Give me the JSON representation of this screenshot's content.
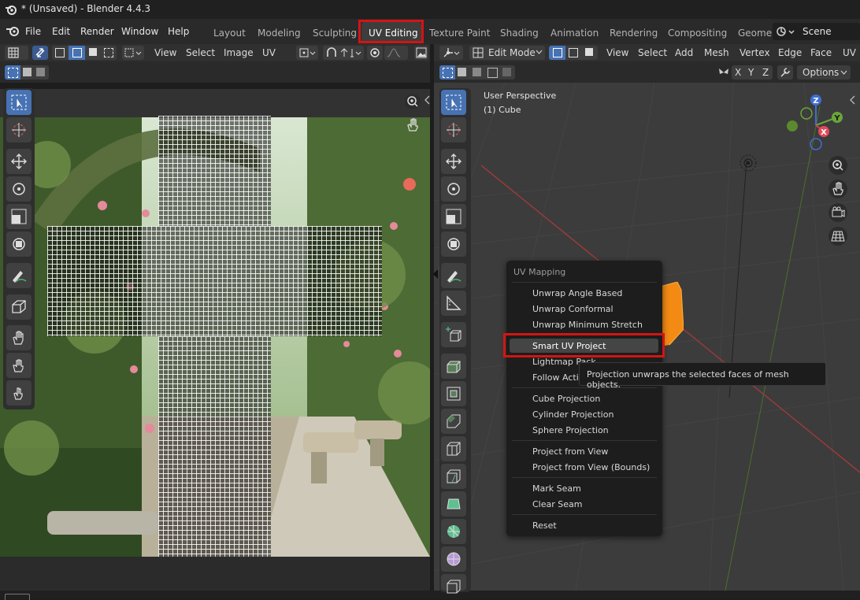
{
  "window": {
    "title": "* (Unsaved) - Blender 4.4.3"
  },
  "menu": [
    "File",
    "Edit",
    "Render",
    "Window",
    "Help"
  ],
  "workspaces": [
    {
      "label": "Layout",
      "active": false
    },
    {
      "label": "Modeling",
      "active": false
    },
    {
      "label": "Sculpting",
      "active": false
    },
    {
      "label": "UV Editing",
      "active": true
    },
    {
      "label": "Texture Paint",
      "active": false
    },
    {
      "label": "Shading",
      "active": false
    },
    {
      "label": "Animation",
      "active": false
    },
    {
      "label": "Rendering",
      "active": false
    },
    {
      "label": "Compositing",
      "active": false
    },
    {
      "label": "Geome",
      "active": false
    }
  ],
  "scene": {
    "label": "Scene"
  },
  "uv_editor": {
    "header_menus": [
      "View",
      "Select",
      "Image",
      "UV"
    ]
  },
  "viewport": {
    "mode": "Edit Mode",
    "header_menus": [
      "View",
      "Select",
      "Add",
      "Mesh",
      "Vertex",
      "Edge",
      "Face",
      "UV"
    ],
    "axes": [
      "X",
      "Y",
      "Z"
    ],
    "options_label": "Options",
    "perspective": "User Perspective",
    "object": "(1) Cube",
    "gizmo": {
      "x": "X",
      "y": "Y",
      "z": "Z"
    }
  },
  "uv_menu": {
    "title": "UV Mapping",
    "items": [
      "Unwrap Angle Based",
      "Unwrap Conformal",
      "Unwrap Minimum Stretch",
      "Smart UV Project",
      "Lightmap Pack",
      "Follow Acti",
      "Cube Projection",
      "Cylinder Projection",
      "Sphere Projection",
      "Project from View",
      "Project from View (Bounds)",
      "Mark Seam",
      "Clear Seam",
      "Reset"
    ],
    "highlighted": "Smart UV Project"
  },
  "tooltip": {
    "text": "Projection unwraps the selected faces of mesh objects."
  },
  "colors": {
    "highlight_red": "#d41414",
    "selected_blue": "#4772b3",
    "mesh_orange": "#f28a14"
  }
}
